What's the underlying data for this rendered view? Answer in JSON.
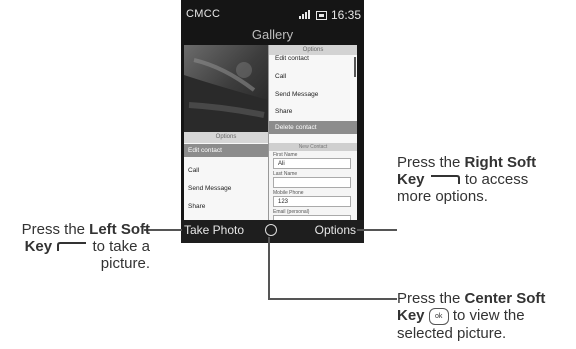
{
  "status_bar": {
    "carrier": "CMCC",
    "time": "16:35"
  },
  "app": {
    "title": "Gallery"
  },
  "right_options": {
    "header": "Options",
    "items": [
      "Edit contact",
      "Call",
      "Send Message",
      "Share"
    ],
    "highlighted": "Delete contact"
  },
  "contact_form": {
    "header": "New Contact",
    "fields": [
      {
        "label": "First Name",
        "value": "Ali"
      },
      {
        "label": "Last Name",
        "value": ""
      },
      {
        "label": "Mobile Phone",
        "value": "123"
      },
      {
        "label": "Email (personal)",
        "value": ""
      }
    ]
  },
  "left_options": {
    "header": "Options",
    "highlighted": "Edit contact",
    "items": [
      "Call",
      "Send Message",
      "Share"
    ]
  },
  "softkeys": {
    "left": "Take Photo",
    "right": "Options"
  },
  "callouts": {
    "left": {
      "pre": "Press the ",
      "bold": "Left Soft Key",
      "post": " to take a picture."
    },
    "right": {
      "pre": "Press the ",
      "bold": "Right Soft Key",
      "post": " to access more options."
    },
    "center": {
      "pre": "Press the ",
      "bold": "Center Soft Key",
      "post": " to view the selected picture.",
      "key": "ok"
    }
  }
}
